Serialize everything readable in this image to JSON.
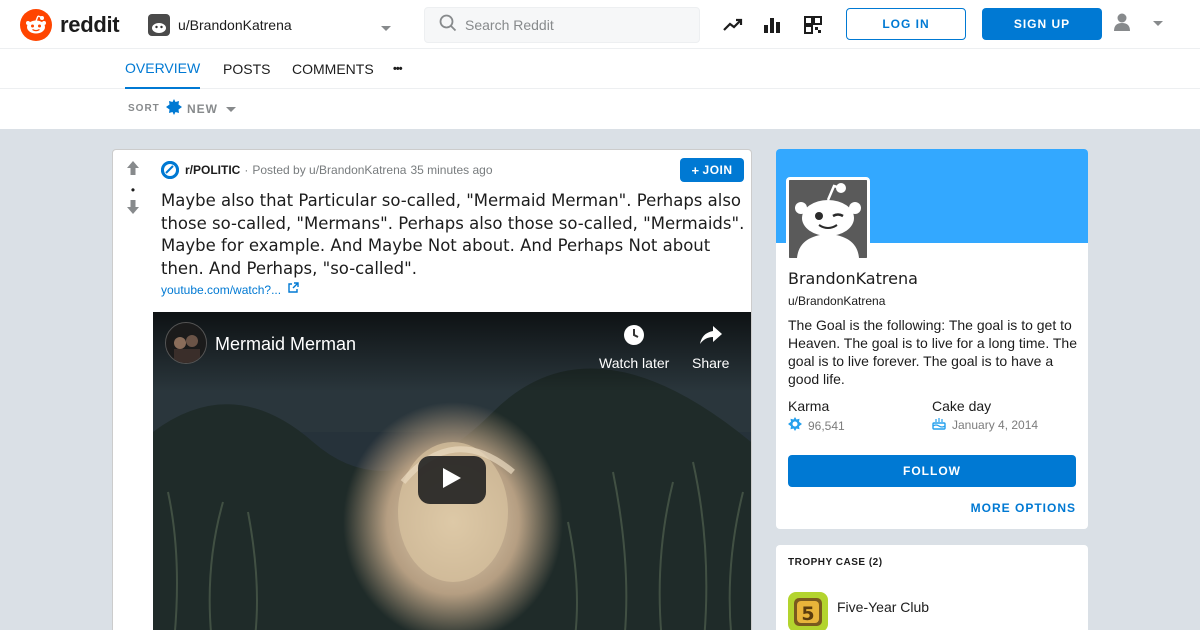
{
  "header": {
    "logo_text": "reddit",
    "user_dropdown_label": "u/BrandonKatrena",
    "search_placeholder": "Search Reddit",
    "login_label": "LOG IN",
    "signup_label": "SIGN UP",
    "brand_color": "#ff4500",
    "accent_color": "#0079d3"
  },
  "tabs": {
    "overview": "OVERVIEW",
    "posts": "POSTS",
    "comments": "COMMENTS",
    "more": "•••"
  },
  "sort": {
    "label": "SORT",
    "value": "NEW"
  },
  "post": {
    "subreddit": "r/POLITIC",
    "posted_by": "Posted by u/BrandonKatrena",
    "age": "35 minutes ago",
    "join_label": "JOIN",
    "title": "Maybe also that Particular so-called, \"Mermaid Merman\". Perhaps also those so-called, \"Mermans\". Perhaps also those so-called, \"Mermaids\". Maybe for example. And Maybe Not about. And Perhaps Not about then. And Perhaps, \"so-called\".",
    "link_text": "youtube.com/watch?...",
    "vote_separator": "•",
    "video": {
      "title": "Mermaid Merman",
      "watch_later": "Watch later",
      "share": "Share"
    }
  },
  "profile": {
    "display_name": "BrandonKatrena",
    "handle": "u/BrandonKatrena",
    "bio": "The Goal is the following: The goal is to get to Heaven. The goal is to live for a long time. The goal is to live forever. The goal is to have a good life.",
    "karma_label": "Karma",
    "karma_value": "96,541",
    "cake_label": "Cake day",
    "cake_value": "January 4, 2014",
    "follow_label": "FOLLOW",
    "more_options": "MORE OPTIONS",
    "banner_color": "#33a8ff"
  },
  "trophies": {
    "heading": "TROPHY CASE (2)",
    "items": [
      {
        "name": "Five-Year Club",
        "icon": "five-year-club-icon",
        "badge_text": "5"
      }
    ]
  }
}
